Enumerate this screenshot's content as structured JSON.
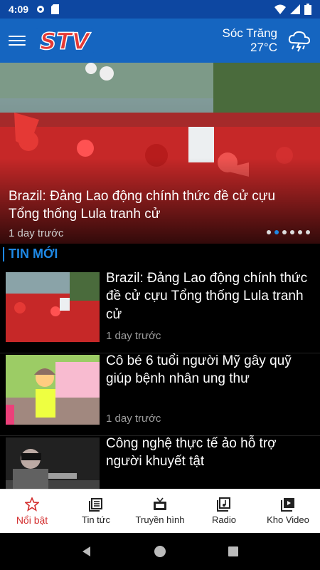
{
  "status_bar": {
    "time": "4:09"
  },
  "app_bar": {
    "logo_text": "STV",
    "weather": {
      "city": "Sóc Trăng",
      "temperature": "27°C",
      "icon": "cloud-rain-lightning-icon"
    }
  },
  "hero": {
    "title": "Brazil: Đảng Lao động chính thức đề cử cựu Tổng thống Lula tranh cử",
    "time": "1 day trước",
    "dots_count": 6,
    "active_dot": 1
  },
  "section": {
    "title": "TIN MỚI"
  },
  "news": [
    {
      "title": "Brazil: Đảng Lao động chính thức đề cử cựu Tổng thống Lula tranh cử",
      "time": "1 day trước"
    },
    {
      "title": "Cô bé 6 tuổi người Mỹ gây quỹ giúp bệnh nhân ung thư",
      "time": "1 day trước"
    },
    {
      "title": "Công nghệ thực tế ảo hỗ trợ người khuyết tật",
      "time": ""
    }
  ],
  "bottom_nav": [
    {
      "label": "Nổi bật",
      "icon": "star-icon",
      "active": true
    },
    {
      "label": "Tin tức",
      "icon": "news-icon",
      "active": false
    },
    {
      "label": "Truyền hình",
      "icon": "tv-icon",
      "active": false
    },
    {
      "label": "Radio",
      "icon": "radio-icon",
      "active": false
    },
    {
      "label": "Kho Video",
      "icon": "video-library-icon",
      "active": false
    }
  ],
  "colors": {
    "primary": "#1565c0",
    "accent_blue": "#1e88e5",
    "active_nav": "#d32f2f",
    "logo_red": "#e53935"
  }
}
